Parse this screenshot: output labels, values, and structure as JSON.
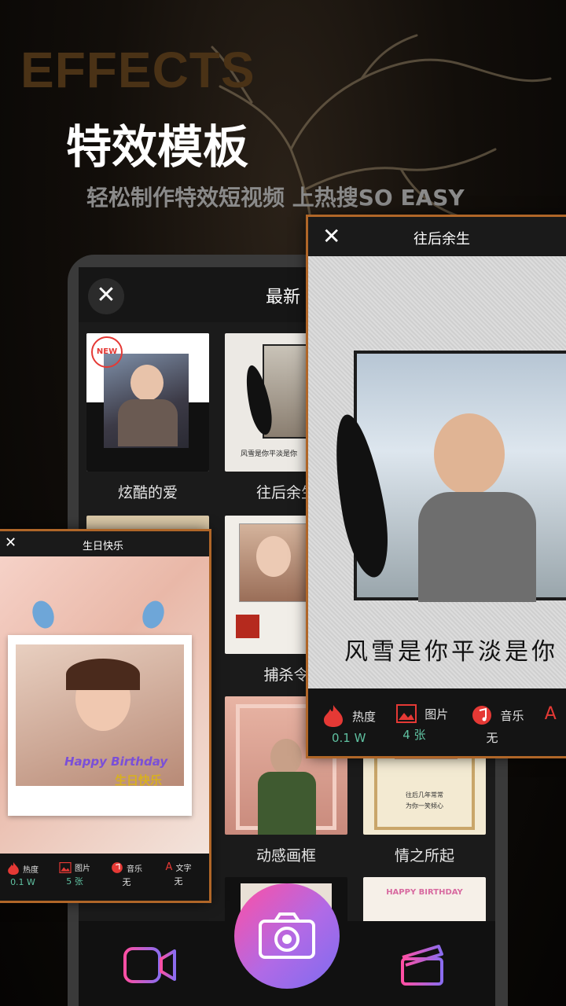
{
  "banner": {
    "en_title": "EFFECTS",
    "title": "特效模板",
    "subtitle": "轻松制作特效短视频 上热搜SO EASY"
  },
  "screen": {
    "header_title": "最新",
    "tiles": [
      {
        "label": "炫酷的爱"
      },
      {
        "label": "往后余生"
      },
      {
        "label": "捕杀令"
      },
      {
        "label": "动感画框"
      },
      {
        "label": "情之所起"
      }
    ],
    "tile_badge": "NEW",
    "feather_poem": "风雪是你平淡是你",
    "tile5_caption_1": "往后几年常常",
    "tile5_caption_2": "为你一笑倾心",
    "tile6_banner": "HAPPY BIRTHDAY"
  },
  "card_right": {
    "title": "往后余生",
    "poem": "风雪是你平淡是你",
    "stats": [
      {
        "label": "热度",
        "value": "0.1 W",
        "icon": "flame-icon"
      },
      {
        "label": "图片",
        "value": "4 张",
        "icon": "image-icon"
      },
      {
        "label": "音乐",
        "value": "无",
        "icon": "music-icon"
      },
      {
        "label": "A",
        "value": "",
        "icon": "text-icon"
      }
    ]
  },
  "card_left": {
    "title": "生日快乐",
    "happy": "Happy Birthday",
    "cn_happy": "生日快乐",
    "stats": [
      {
        "label": "热度",
        "value": "0.1 W",
        "icon": "flame-icon"
      },
      {
        "label": "图片",
        "value": "5 张",
        "icon": "image-icon"
      },
      {
        "label": "音乐",
        "value": "无",
        "icon": "music-icon"
      },
      {
        "label": "文字",
        "value": "无",
        "icon": "text-icon"
      }
    ]
  },
  "colors": {
    "accent_orange": "#b06628",
    "hot_green": "#5fc0a0",
    "flame_red": "#e53935",
    "camera_gradient_start": "#ff4fa3",
    "camera_gradient_end": "#7d6cf0"
  }
}
